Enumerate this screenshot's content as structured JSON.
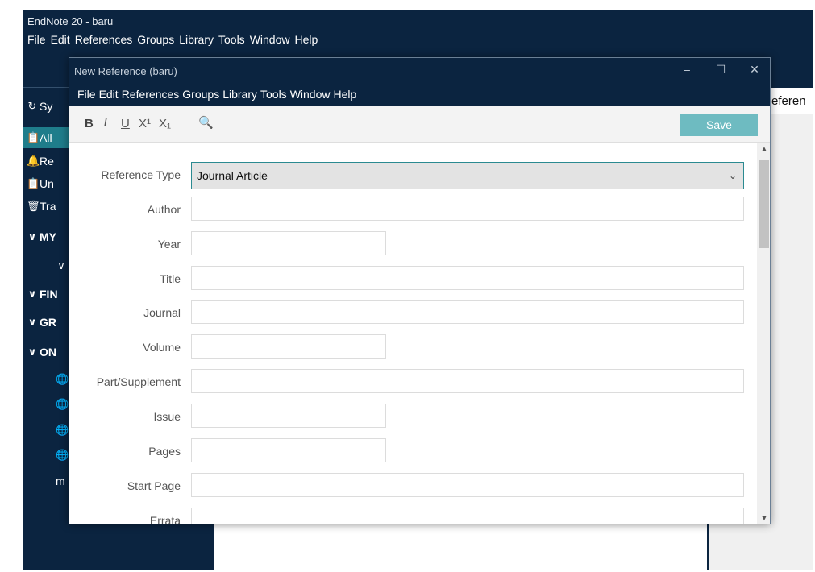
{
  "main": {
    "title": "EndNote 20 - baru",
    "menu": [
      "File",
      "Edit",
      "References",
      "Groups",
      "Library",
      "Tools",
      "Window",
      "Help"
    ]
  },
  "sidebar": {
    "items": [
      {
        "icon": "sync-icon",
        "glyph": "↻",
        "label": "Sy"
      },
      {
        "icon": "clipboard-icon",
        "glyph": "📋",
        "label": "All"
      },
      {
        "icon": "bell-icon",
        "glyph": "🔔",
        "label": "Re"
      },
      {
        "icon": "clipboard-icon",
        "glyph": "📋",
        "label": "Un"
      },
      {
        "icon": "trash-icon",
        "glyph": "🗑",
        "label": "Tra"
      },
      {
        "icon": "chevron-down-icon",
        "glyph": "∨",
        "label": "MY"
      },
      {
        "icon": "chevron-down-icon",
        "glyph": "∨",
        "label": ""
      },
      {
        "icon": "chevron-down-icon",
        "glyph": "∨",
        "label": "FIN"
      },
      {
        "icon": "chevron-down-icon",
        "glyph": "∨",
        "label": "GR"
      },
      {
        "icon": "chevron-down-icon",
        "glyph": "∨",
        "label": "ON"
      },
      {
        "icon": "globe-icon",
        "glyph": "🌐",
        "label": ""
      },
      {
        "icon": "globe-icon",
        "glyph": "🌐",
        "label": ""
      },
      {
        "icon": "globe-icon",
        "glyph": "🌐",
        "label": ""
      },
      {
        "icon": "globe-icon",
        "glyph": "🌐",
        "label": ""
      },
      {
        "icon": "",
        "glyph": "",
        "label": "m"
      }
    ]
  },
  "right_pane": {
    "tab_label": "eferen"
  },
  "dialog": {
    "title": "New Reference (baru)",
    "controls": {
      "minimize": "–",
      "maximize": "☐",
      "close": "✕"
    },
    "menu": [
      "File",
      "Edit",
      "References",
      "Groups",
      "Library",
      "Tools",
      "Window",
      "Help"
    ],
    "toolbar": {
      "bold": "B",
      "italic": "I",
      "underline": "U",
      "superscript": "X¹",
      "subscript": "X₁",
      "search": "🔍"
    },
    "save_label": "Save",
    "reference_type": {
      "label": "Reference Type",
      "value": "Journal Article",
      "arrow": "⌄"
    },
    "fields": [
      {
        "label": "Author",
        "value": ""
      },
      {
        "label": "Year",
        "value": ""
      },
      {
        "label": "Title",
        "value": ""
      },
      {
        "label": "Journal",
        "value": ""
      },
      {
        "label": "Volume",
        "value": ""
      },
      {
        "label": "Part/Supplement",
        "value": ""
      },
      {
        "label": "Issue",
        "value": ""
      },
      {
        "label": "Pages",
        "value": ""
      },
      {
        "label": "Start Page",
        "value": ""
      },
      {
        "label": "Errata",
        "value": ""
      }
    ],
    "scroll": {
      "up": "▲",
      "down": "▼"
    }
  },
  "colors": {
    "navy": "#0b2440",
    "teal": "#1f7d8b",
    "save": "#6ebbc1"
  }
}
